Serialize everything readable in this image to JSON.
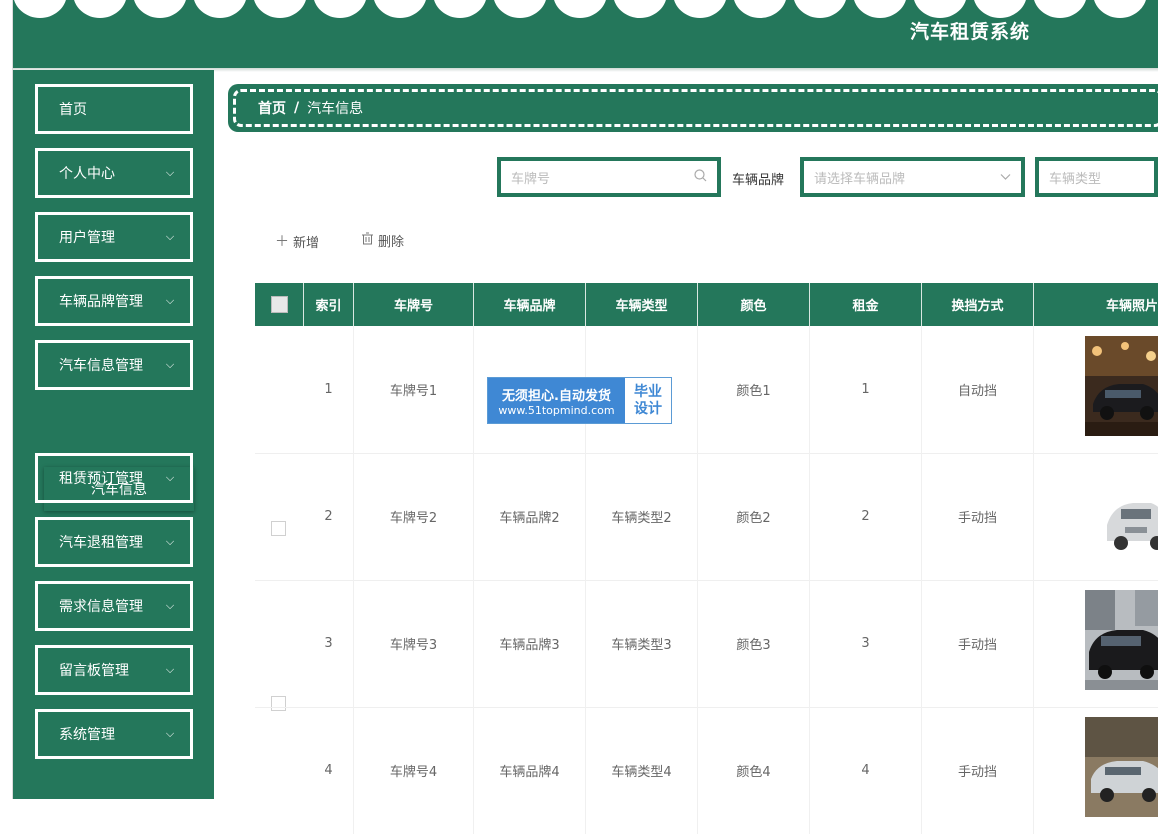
{
  "app": {
    "title": "汽车租赁系统"
  },
  "sidebar": {
    "items": [
      {
        "label": "首页",
        "has_children": false
      },
      {
        "label": "个人中心",
        "has_children": true
      },
      {
        "label": "用户管理",
        "has_children": true
      },
      {
        "label": "车辆品牌管理",
        "has_children": true
      },
      {
        "label": "汽车信息管理",
        "has_children": true
      },
      {
        "label": "租赁预订管理",
        "has_children": true
      },
      {
        "label": "汽车退租管理",
        "has_children": true
      },
      {
        "label": "需求信息管理",
        "has_children": true
      },
      {
        "label": "留言板管理",
        "has_children": true
      },
      {
        "label": "系统管理",
        "has_children": true
      }
    ],
    "chevron": "⌵",
    "submenu": {
      "label": "汽车信息"
    }
  },
  "breadcrumb": {
    "home": "首页",
    "separator": "/",
    "current": "汽车信息"
  },
  "search": {
    "plate_placeholder": "车牌号",
    "brand_label": "车辆品牌",
    "brand_placeholder": "请选择车辆品牌",
    "type_placeholder": "车辆类型"
  },
  "actions": {
    "add": "新增",
    "delete": "删除"
  },
  "table": {
    "columns": [
      "索引",
      "车牌号",
      "车辆品牌",
      "车辆类型",
      "颜色",
      "租金",
      "换挡方式",
      "车辆照片"
    ],
    "rows": [
      {
        "index": "1",
        "plate": "车牌号1",
        "brand": "",
        "type": "",
        "color": "颜色1",
        "rent": "1",
        "gear": "自动挡"
      },
      {
        "index": "2",
        "plate": "车牌号2",
        "brand": "车辆品牌2",
        "type": "车辆类型2",
        "color": "颜色2",
        "rent": "2",
        "gear": "手动挡"
      },
      {
        "index": "3",
        "plate": "车牌号3",
        "brand": "车辆品牌3",
        "type": "车辆类型3",
        "color": "颜色3",
        "rent": "3",
        "gear": "手动挡"
      },
      {
        "index": "4",
        "plate": "车牌号4",
        "brand": "车辆品牌4",
        "type": "车辆类型4",
        "color": "颜色4",
        "rent": "4",
        "gear": "手动挡"
      }
    ]
  },
  "watermark": {
    "line1": "无须担心.自动发货",
    "line2": "www.51topmind.com",
    "badge1": "毕业",
    "badge2": "设计"
  },
  "colors": {
    "primary": "#24775b",
    "watermark": "#3f88d4"
  },
  "icons": {
    "search": "search-icon",
    "dropdown": "chevron-down-icon",
    "add": "plus-icon",
    "delete": "trash-icon"
  }
}
